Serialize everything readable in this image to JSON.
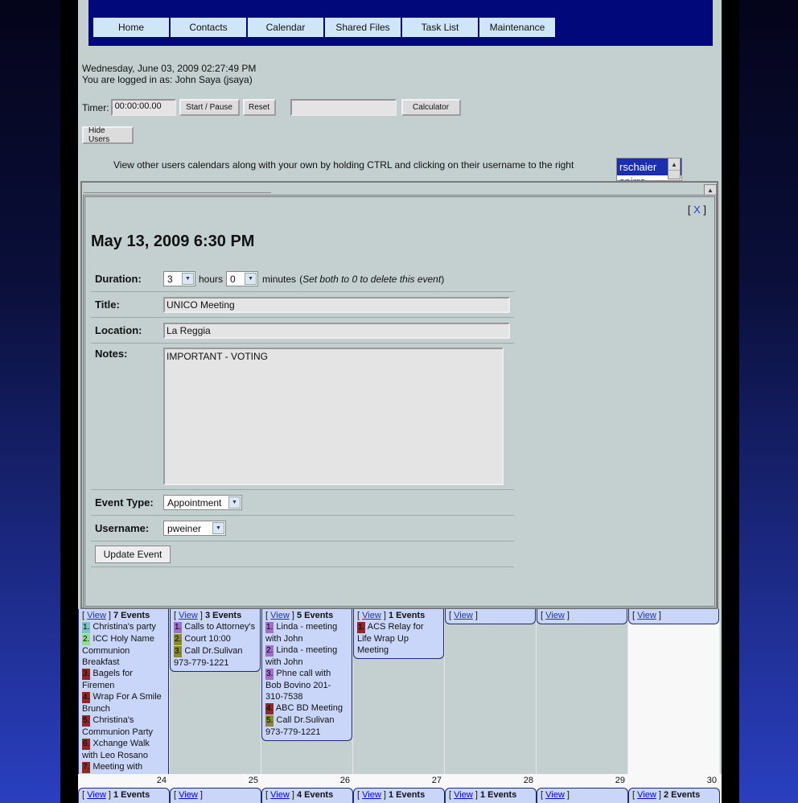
{
  "nav": [
    "Home",
    "Contacts",
    "Calendar",
    "Shared Files",
    "Task List",
    "Maintenance"
  ],
  "header": {
    "datetime": "Wednesday, June 03, 2009 02:27:49 PM",
    "logged_in": "You are logged in as: John Saya (jsaya)"
  },
  "timer": {
    "label": "Timer:",
    "value": "00:00:00.00",
    "start_pause": "Start / Pause",
    "reset": "Reset",
    "calc_value": "",
    "calculator": "Calculator"
  },
  "hide_users": "Hide Users",
  "view_others_text": "View other users calendars along with your own by holding CTRL and clicking on their username to the right",
  "user_list": [
    "rschaier",
    "spirro"
  ],
  "event": {
    "close": "X",
    "title": "May 13, 2009 6:30 PM",
    "duration_label": "Duration:",
    "hours_value": "3",
    "hours_label": "hours",
    "minutes_value": "0",
    "minutes_label": "minutes",
    "delete_hint_pre": "(",
    "delete_hint": "Set both to 0 to delete this event",
    "delete_hint_post": ")",
    "title_label": "Title:",
    "title_value": "UNICO Meeting",
    "location_label": "Location:",
    "location_value": "La Reggia",
    "notes_label": "Notes:",
    "notes_value": "IMPORTANT - VOTING",
    "type_label": "Event Type:",
    "type_value": "Appointment",
    "username_label": "Username:",
    "username_value": "pweiner",
    "update_button": "Update Event"
  },
  "calendar": {
    "view_label": "View",
    "week1": [
      {
        "count": "7 Events",
        "items": [
          {
            "n": "1.",
            "text": "Christina's party",
            "color": "cyan"
          },
          {
            "n": "2.",
            "text": "ICC Holy Name Communion Breakfast",
            "color": "green"
          },
          {
            "n": "3.",
            "text": "Bagels for Firemen",
            "color": "brown"
          },
          {
            "n": "4.",
            "text": "Wrap For A Smile Brunch",
            "color": "brown"
          },
          {
            "n": "5.",
            "text": "Christina's Communion Party",
            "color": "brown"
          },
          {
            "n": "6.",
            "text": "Xchange Walk with Leo Rosano",
            "color": "brown"
          },
          {
            "n": "7.",
            "text": "Meeting with Independents",
            "color": "brown"
          }
        ]
      },
      {
        "count": "3 Events",
        "items": [
          {
            "n": "1.",
            "text": "Calls to Attorney's",
            "color": "purple"
          },
          {
            "n": "2.",
            "text": "Court 10:00",
            "color": "olive"
          },
          {
            "n": "3.",
            "text": "Call Dr.Sulivan 973-779-1221",
            "color": "olive"
          }
        ]
      },
      {
        "count": "5 Events",
        "items": [
          {
            "n": "1.",
            "text": "Linda - meeting with John",
            "color": "purple"
          },
          {
            "n": "2.",
            "text": "Linda - meeting with John",
            "color": "purple"
          },
          {
            "n": "3.",
            "text": "Phne call with Bob Bovino 201-310-7538",
            "color": "purple"
          },
          {
            "n": "4.",
            "text": "ABC BD Meeting",
            "color": "brown"
          },
          {
            "n": "5.",
            "text": "Call Dr.Sulivan 973-779-1221",
            "color": "olive"
          }
        ]
      },
      {
        "count": "1 Events",
        "items": [
          {
            "n": "1.",
            "text": "ACS Relay for Life Wrap Up Meeting",
            "color": "brown"
          }
        ]
      },
      {
        "count": "",
        "items": []
      },
      {
        "count": "",
        "items": []
      },
      {
        "count": "",
        "items": []
      }
    ],
    "day_numbers": [
      "24",
      "25",
      "26",
      "27",
      "28",
      "29",
      "30"
    ],
    "week2_counts": [
      "1 Events",
      "",
      "4 Events",
      "1 Events",
      "1 Events",
      "",
      "2 Events"
    ]
  }
}
